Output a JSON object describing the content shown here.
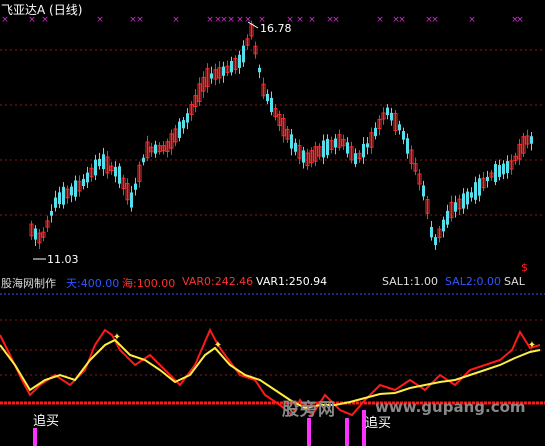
{
  "header": {
    "title": "飞亚达A (日线)"
  },
  "labels": {
    "high": "16.78",
    "low": "11.03"
  },
  "indicator": {
    "source": "股海网制作",
    "t1": "天:400.00",
    "t2": "海:100.00",
    "var0": "VAR0:242.46",
    "var1": "VAR1:250.94",
    "sal1": "SAL1:1.00",
    "sal2": "SAL2:0.00",
    "sal": "SAL"
  },
  "signals": {
    "chase_buy": "追买"
  },
  "watermark": {
    "brand": "股旁网",
    "url": "www.gupang.com"
  },
  "colors": {
    "up": "#ff2a2a",
    "down": "#55e0ee",
    "line_a": "#ff1a1a",
    "line_b": "#ffee44",
    "marker": "#cc33cc",
    "grid": "#8b1a1a",
    "dashed_blue": "#3355ff"
  }
}
